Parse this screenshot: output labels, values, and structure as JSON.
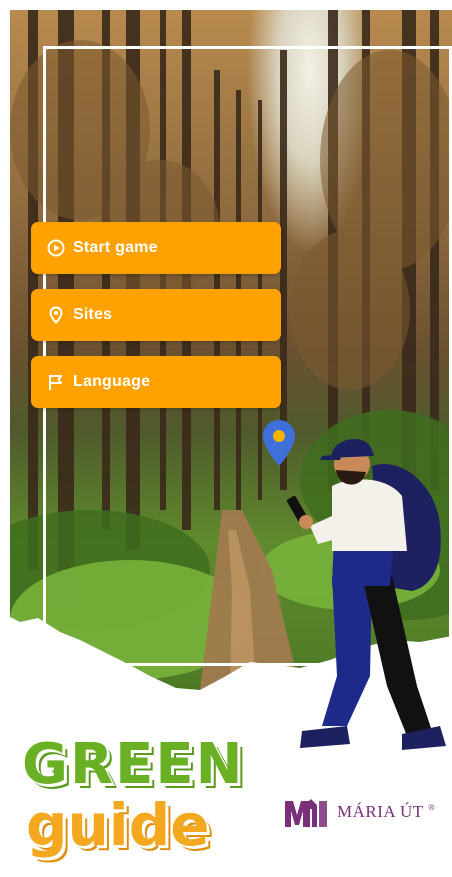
{
  "menu": {
    "items": [
      {
        "label": "Start game",
        "icon": "play-circle-icon"
      },
      {
        "label": "Sites",
        "icon": "location-pin-icon"
      },
      {
        "label": "Language",
        "icon": "flag-icon"
      }
    ]
  },
  "branding": {
    "title_line1": "GREEN",
    "title_line2": "guide",
    "partner_name": "MÁRIA ÚT",
    "partner_mark": "®"
  },
  "colors": {
    "button": "#ffa200",
    "title_green": "#6ab024",
    "title_orange": "#f3a81f",
    "partner_purple": "#7a2f7a",
    "pin_blue": "#3f6fd8"
  }
}
